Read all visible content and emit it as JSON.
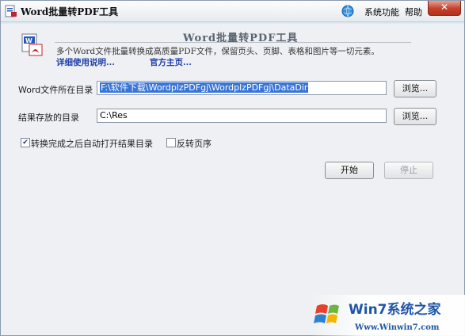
{
  "window": {
    "title": "Word批量转PDF工具",
    "menu": {
      "system": "系统功能",
      "help": "帮助"
    },
    "close_glyph": "✕"
  },
  "header": {
    "tool_title": "Word批量转PDF工具",
    "description": "多个Word文件批量转换成高质量PDF文件，保留页头、页脚、表格和图片等一切元素。",
    "link_usage": "详细使用说明...",
    "link_home": "官方主页..."
  },
  "form": {
    "source_label": "Word文件所在目录",
    "source_value": "F:\\软件下载\\WordplzPDFgj\\WordplzPDFgj\\DataDir",
    "result_label": "结果存放的目录",
    "result_value": "C:\\Res",
    "browse_label": "浏览..."
  },
  "options": {
    "open_after_label": "转换完成之后自动打开结果目录",
    "open_after_checked": true,
    "reverse_label": "反转页序",
    "reverse_checked": false
  },
  "actions": {
    "start": "开始",
    "stop": "停止"
  },
  "watermark": {
    "brand": "Win7系统之家",
    "url": "Www.Winwin7.com"
  },
  "colors": {
    "accent_link": "#1f3ea8",
    "selection": "#3875d7",
    "close": "#c4402b"
  }
}
